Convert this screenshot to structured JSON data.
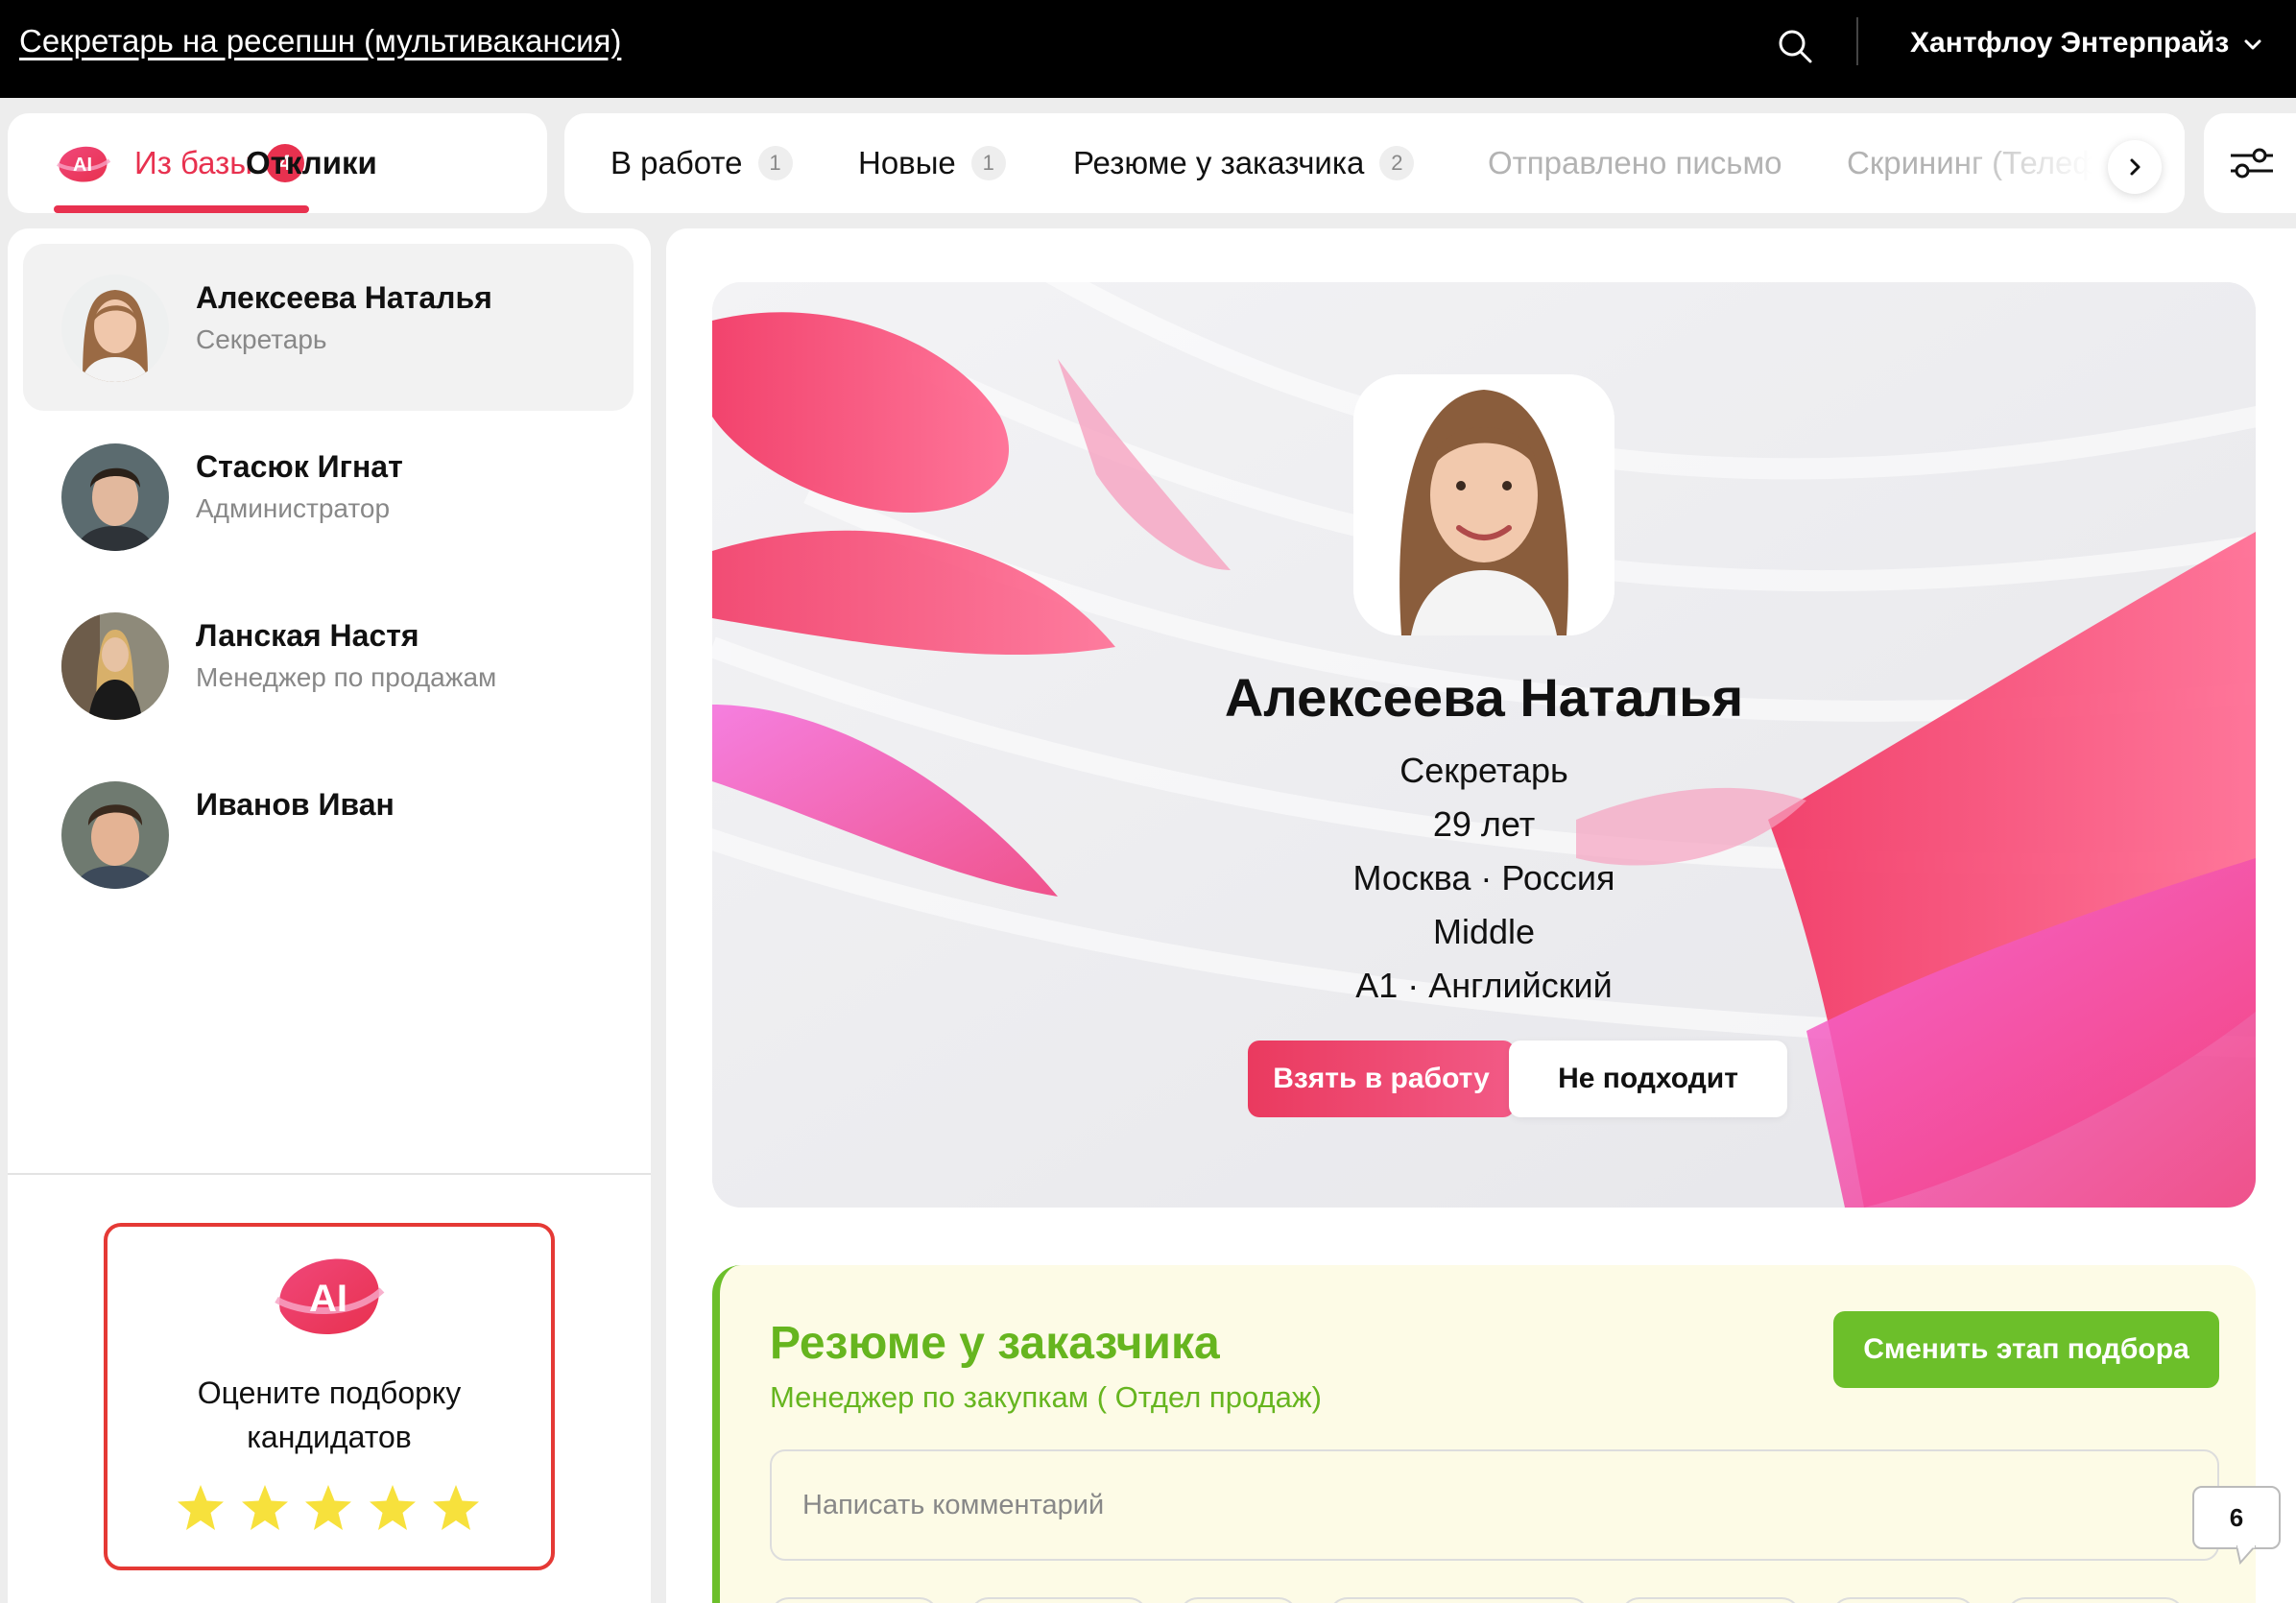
{
  "header": {
    "vacancy_title": "Секретарь на ресепшн (мультивакансия)",
    "company": "Хантфлоу Энтерпрайз"
  },
  "tabs_left": [
    {
      "label": "Из базы",
      "count": "4",
      "active": true,
      "ai": true
    },
    {
      "label": "Отклики"
    }
  ],
  "tabs_main": [
    {
      "label": "В работе",
      "count": "1"
    },
    {
      "label": "Новые",
      "count": "1"
    },
    {
      "label": "Резюме у заказчика",
      "count": "2"
    },
    {
      "label": "Отправлено письмо"
    },
    {
      "label": "Скрининг (Телеф"
    }
  ],
  "candidates": [
    {
      "name": "Алексеева Наталья",
      "role": "Секретарь",
      "selected": true
    },
    {
      "name": "Стасюк Игнат",
      "role": "Администратор"
    },
    {
      "name": "Ланская Настя",
      "role": "Менеджер по продажам"
    },
    {
      "name": "Иванов Иван",
      "role": ""
    }
  ],
  "rating_box": {
    "ai_label": "AI",
    "text_line1": "Оцените подборку",
    "text_line2": "кандидатов",
    "stars": 5
  },
  "profile": {
    "name": "Алексеева Наталья",
    "position": "Секретарь",
    "age": "29 лет",
    "location": "Москва · Россия",
    "level": "Middle",
    "language": "A1 · Английский",
    "take_button": "Взять в работу",
    "reject_button": "Не подходит"
  },
  "stage": {
    "title": "Резюме у заказчика",
    "subtitle": "Менеджер по закупкам ( Отдел продаж)",
    "change_button": "Сменить этап подбора",
    "comment_placeholder": "Написать комментарий"
  },
  "comment_bubble_count": "6",
  "colors": {
    "accent": "#e8314f",
    "stage_green": "#6cbf2a",
    "topbar": "#000000"
  }
}
